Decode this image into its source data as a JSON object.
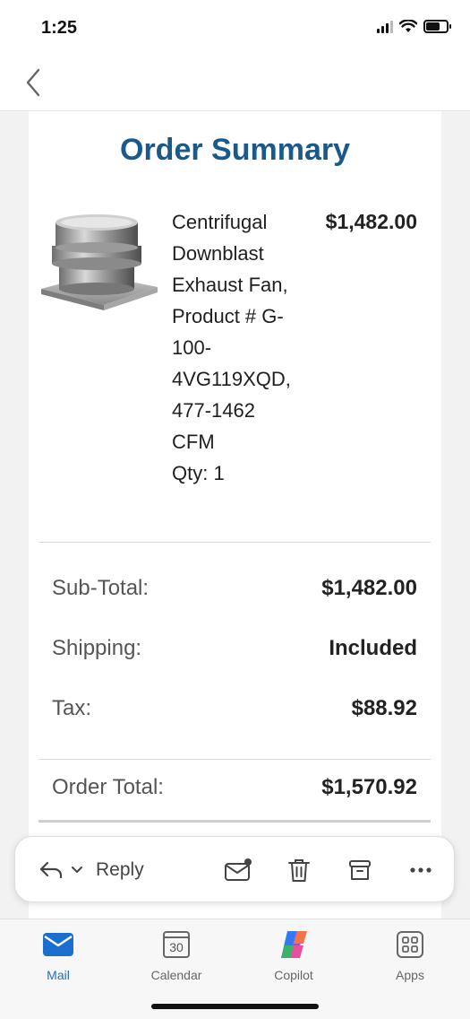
{
  "status": {
    "time": "1:25"
  },
  "email": {
    "title": "Order Summary",
    "product": {
      "description_lines": [
        "Centrifugal",
        "Downblast",
        "Exhaust Fan,",
        "Product # G-",
        "100-",
        "4VG119XQD,",
        "477-1462",
        "CFM"
      ],
      "qty": "Qty: 1",
      "price": "$1,482.00"
    },
    "totals": {
      "subtotal_label": "Sub-Total:",
      "subtotal_value": "$1,482.00",
      "shipping_label": "Shipping:",
      "shipping_value": "Included",
      "tax_label": "Tax:",
      "tax_value": "$88.92",
      "order_total_label": "Order Total:",
      "order_total_value": "$1,570.92"
    }
  },
  "action_bar": {
    "reply_label": "Reply"
  },
  "tabs": [
    {
      "label": "Mail",
      "icon": "mail-icon",
      "active": true
    },
    {
      "label": "Calendar",
      "icon": "calendar-icon",
      "day": "30"
    },
    {
      "label": "Copilot",
      "icon": "copilot-icon"
    },
    {
      "label": "Apps",
      "icon": "apps-icon"
    }
  ],
  "colors": {
    "title": "#1a5a8a",
    "accent": "#1a6fce"
  }
}
